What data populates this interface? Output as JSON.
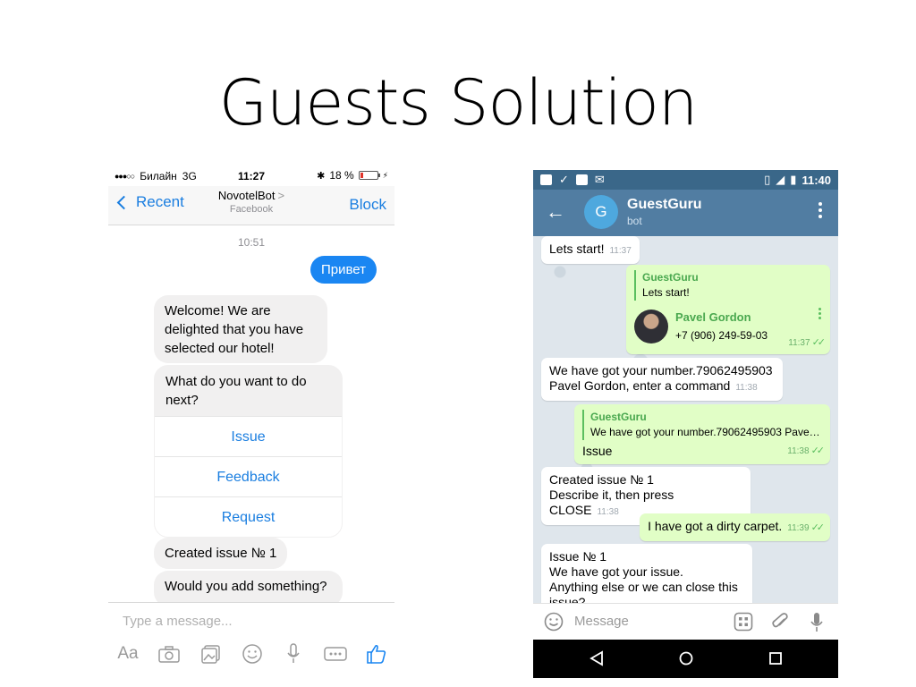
{
  "slide": {
    "title": "Guests Solution"
  },
  "messenger": {
    "status": {
      "carrier": "Билайн",
      "network": "3G",
      "time": "11:27",
      "battery": "18 %",
      "battery_level": 0.18
    },
    "nav": {
      "back_label": "Recent",
      "name": "NovotelBot",
      "name_arrow": ">",
      "subtitle": "Facebook",
      "block_label": "Block"
    },
    "timestamp": "10:51",
    "messages": {
      "sent": "Привет",
      "welcome": "Welcome! We are delighted that you have selected our hotel!",
      "question": "What do you want to do next?",
      "options": [
        "Issue",
        "Feedback",
        "Request"
      ],
      "created": "Created issue № 1",
      "partial": "Would you add something?"
    },
    "composer": {
      "placeholder": "Type a message...",
      "aa_label": "Aa"
    },
    "accent_color": "#1a86f2"
  },
  "telegram": {
    "status": {
      "time": "11:40"
    },
    "header": {
      "back": "←",
      "avatar_letter": "G",
      "name": "GuestGuru",
      "subtitle": "bot"
    },
    "messages": [
      {
        "text": "Lets start!",
        "time": "11:37"
      },
      {
        "reply_name": "GuestGuru",
        "reply_text": "Lets start!",
        "contact_name": "Pavel Gordon",
        "contact_phone": "+7 (906) 249-59-03",
        "time": "11:37"
      },
      {
        "line1": "We have got your number.79062495903",
        "line2": "Pavel Gordon, enter a command",
        "time": "11:38"
      },
      {
        "reply_name": "GuestGuru",
        "reply_text": "We have got your number.79062495903 Pave…",
        "text": "Issue",
        "time": "11:38"
      },
      {
        "line1": "Created issue № 1",
        "line2": "Describe it, then press CLOSE",
        "time": "11:38"
      },
      {
        "text": "I have got a dirty carpet.",
        "time": "11:39"
      },
      {
        "line1": "Issue № 1",
        "line2": "We have got your issue.",
        "line3": "Anything else or we can close this",
        "line4": "issue?"
      }
    ],
    "input": {
      "placeholder": "Message"
    },
    "header_color": "#517da2",
    "outgoing_color": "#e1fec6"
  }
}
